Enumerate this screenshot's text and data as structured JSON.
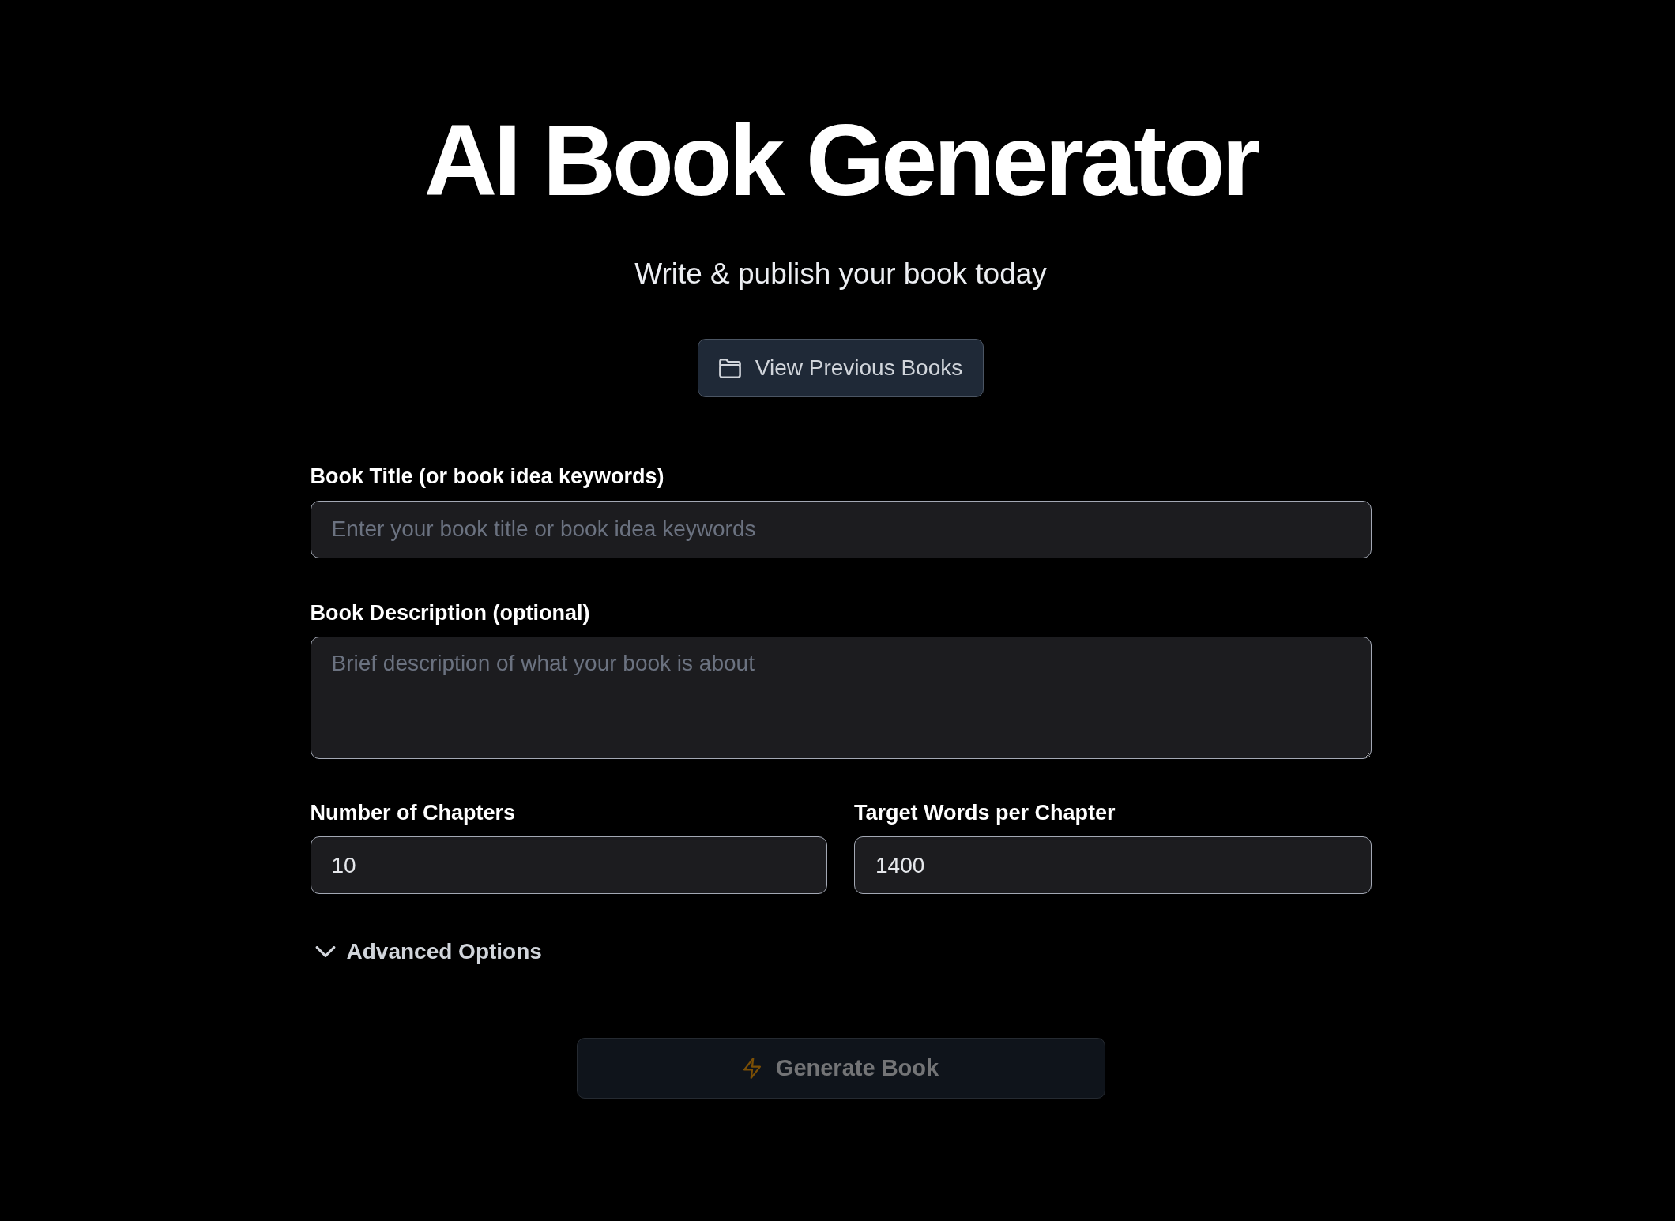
{
  "header": {
    "title": "AI Book Generator",
    "subtitle": "Write & publish your book today"
  },
  "view_previous_button": {
    "label": "View Previous Books"
  },
  "form": {
    "fields": [
      {
        "kind": "input",
        "label": "Book Title (or book idea keywords)",
        "placeholder": "Enter your book title or book idea keywords"
      },
      {
        "kind": "textarea",
        "label": "Book Description (optional)",
        "placeholder": "Brief description of what your book is about"
      }
    ],
    "pair_fields": [
      {
        "label": "Number of Chapters",
        "value": "10"
      },
      {
        "label": "Target Words per Chapter",
        "value": "1400"
      }
    ],
    "advanced_options": {
      "label": "Advanced Options",
      "expanded": false
    }
  },
  "generate_button": {
    "label": "Generate Book",
    "disabled": true
  }
}
